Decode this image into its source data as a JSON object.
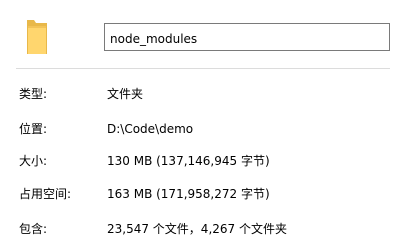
{
  "header": {
    "icon": "folder-icon",
    "name_value": "node_modules",
    "icon_colors": {
      "folder_body": "#FFD66E",
      "folder_back": "#E8B84A",
      "folder_tab": "#F2C358"
    }
  },
  "properties": [
    {
      "label": "类型:",
      "value": "文件夹"
    },
    {
      "label": "位置:",
      "value": "D:\\Code\\demo"
    },
    {
      "label": "大小:",
      "value": "130 MB (137,146,945 字节)"
    },
    {
      "label": "占用空间:",
      "value": "163 MB (171,958,272 字节)"
    },
    {
      "label": "包含:",
      "value": "23,547 个文件，4,267 个文件夹"
    }
  ]
}
